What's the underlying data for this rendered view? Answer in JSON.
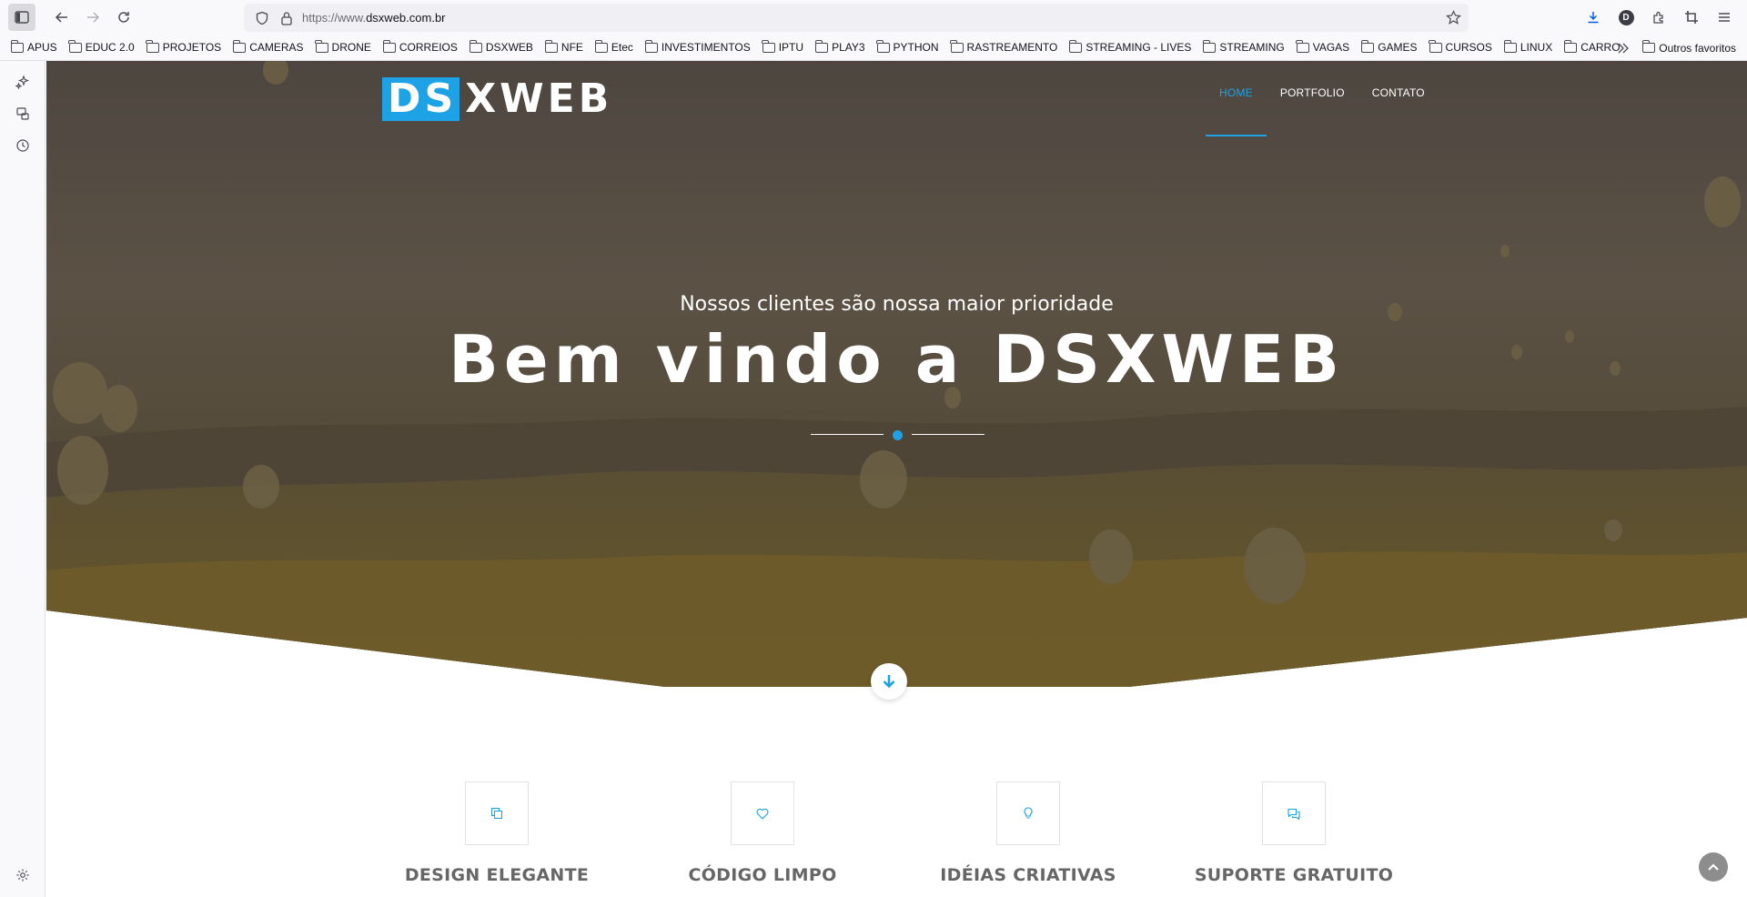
{
  "browser": {
    "url_prefix": "https://www.",
    "url_domain": "dsxweb.com.br",
    "profile_initial": "D",
    "bookmarks": [
      "APUS",
      "EDUC 2.0",
      "PROJETOS",
      "CAMERAS",
      "DRONE",
      "CORREIOS",
      "DSXWEB",
      "NFE",
      "Etec",
      "INVESTIMENTOS",
      "IPTU",
      "PLAY3",
      "PYTHON",
      "RASTREAMENTO",
      "STREAMING - LIVES",
      "STREAMING",
      "VAGAS",
      "GAMES",
      "CURSOS",
      "LINUX",
      "CARRO"
    ],
    "other_bookmarks": "Outros favoritos"
  },
  "site": {
    "logo_ds": "DS",
    "logo_xweb": "XWEB",
    "nav": [
      {
        "label": "HOME",
        "active": true
      },
      {
        "label": "PORTFOLIO",
        "active": false
      },
      {
        "label": "CONTATO",
        "active": false
      }
    ],
    "hero": {
      "subtitle": "Nossos clientes são nossa maior prioridade",
      "title": "Bem vindo a DSXWEB"
    },
    "features": [
      {
        "title": "DESIGN ELEGANTE",
        "icon": "copy-icon"
      },
      {
        "title": "CÓDIGO LIMPO",
        "icon": "heart-icon"
      },
      {
        "title": "IDÉIAS CRIATIVAS",
        "icon": "lightbulb-icon"
      },
      {
        "title": "SUPORTE GRATUITO",
        "icon": "chat-icon"
      }
    ]
  },
  "colors": {
    "accent": "#1da2e6",
    "hero_overlay": "#4a4239",
    "feature_title": "#666666"
  }
}
